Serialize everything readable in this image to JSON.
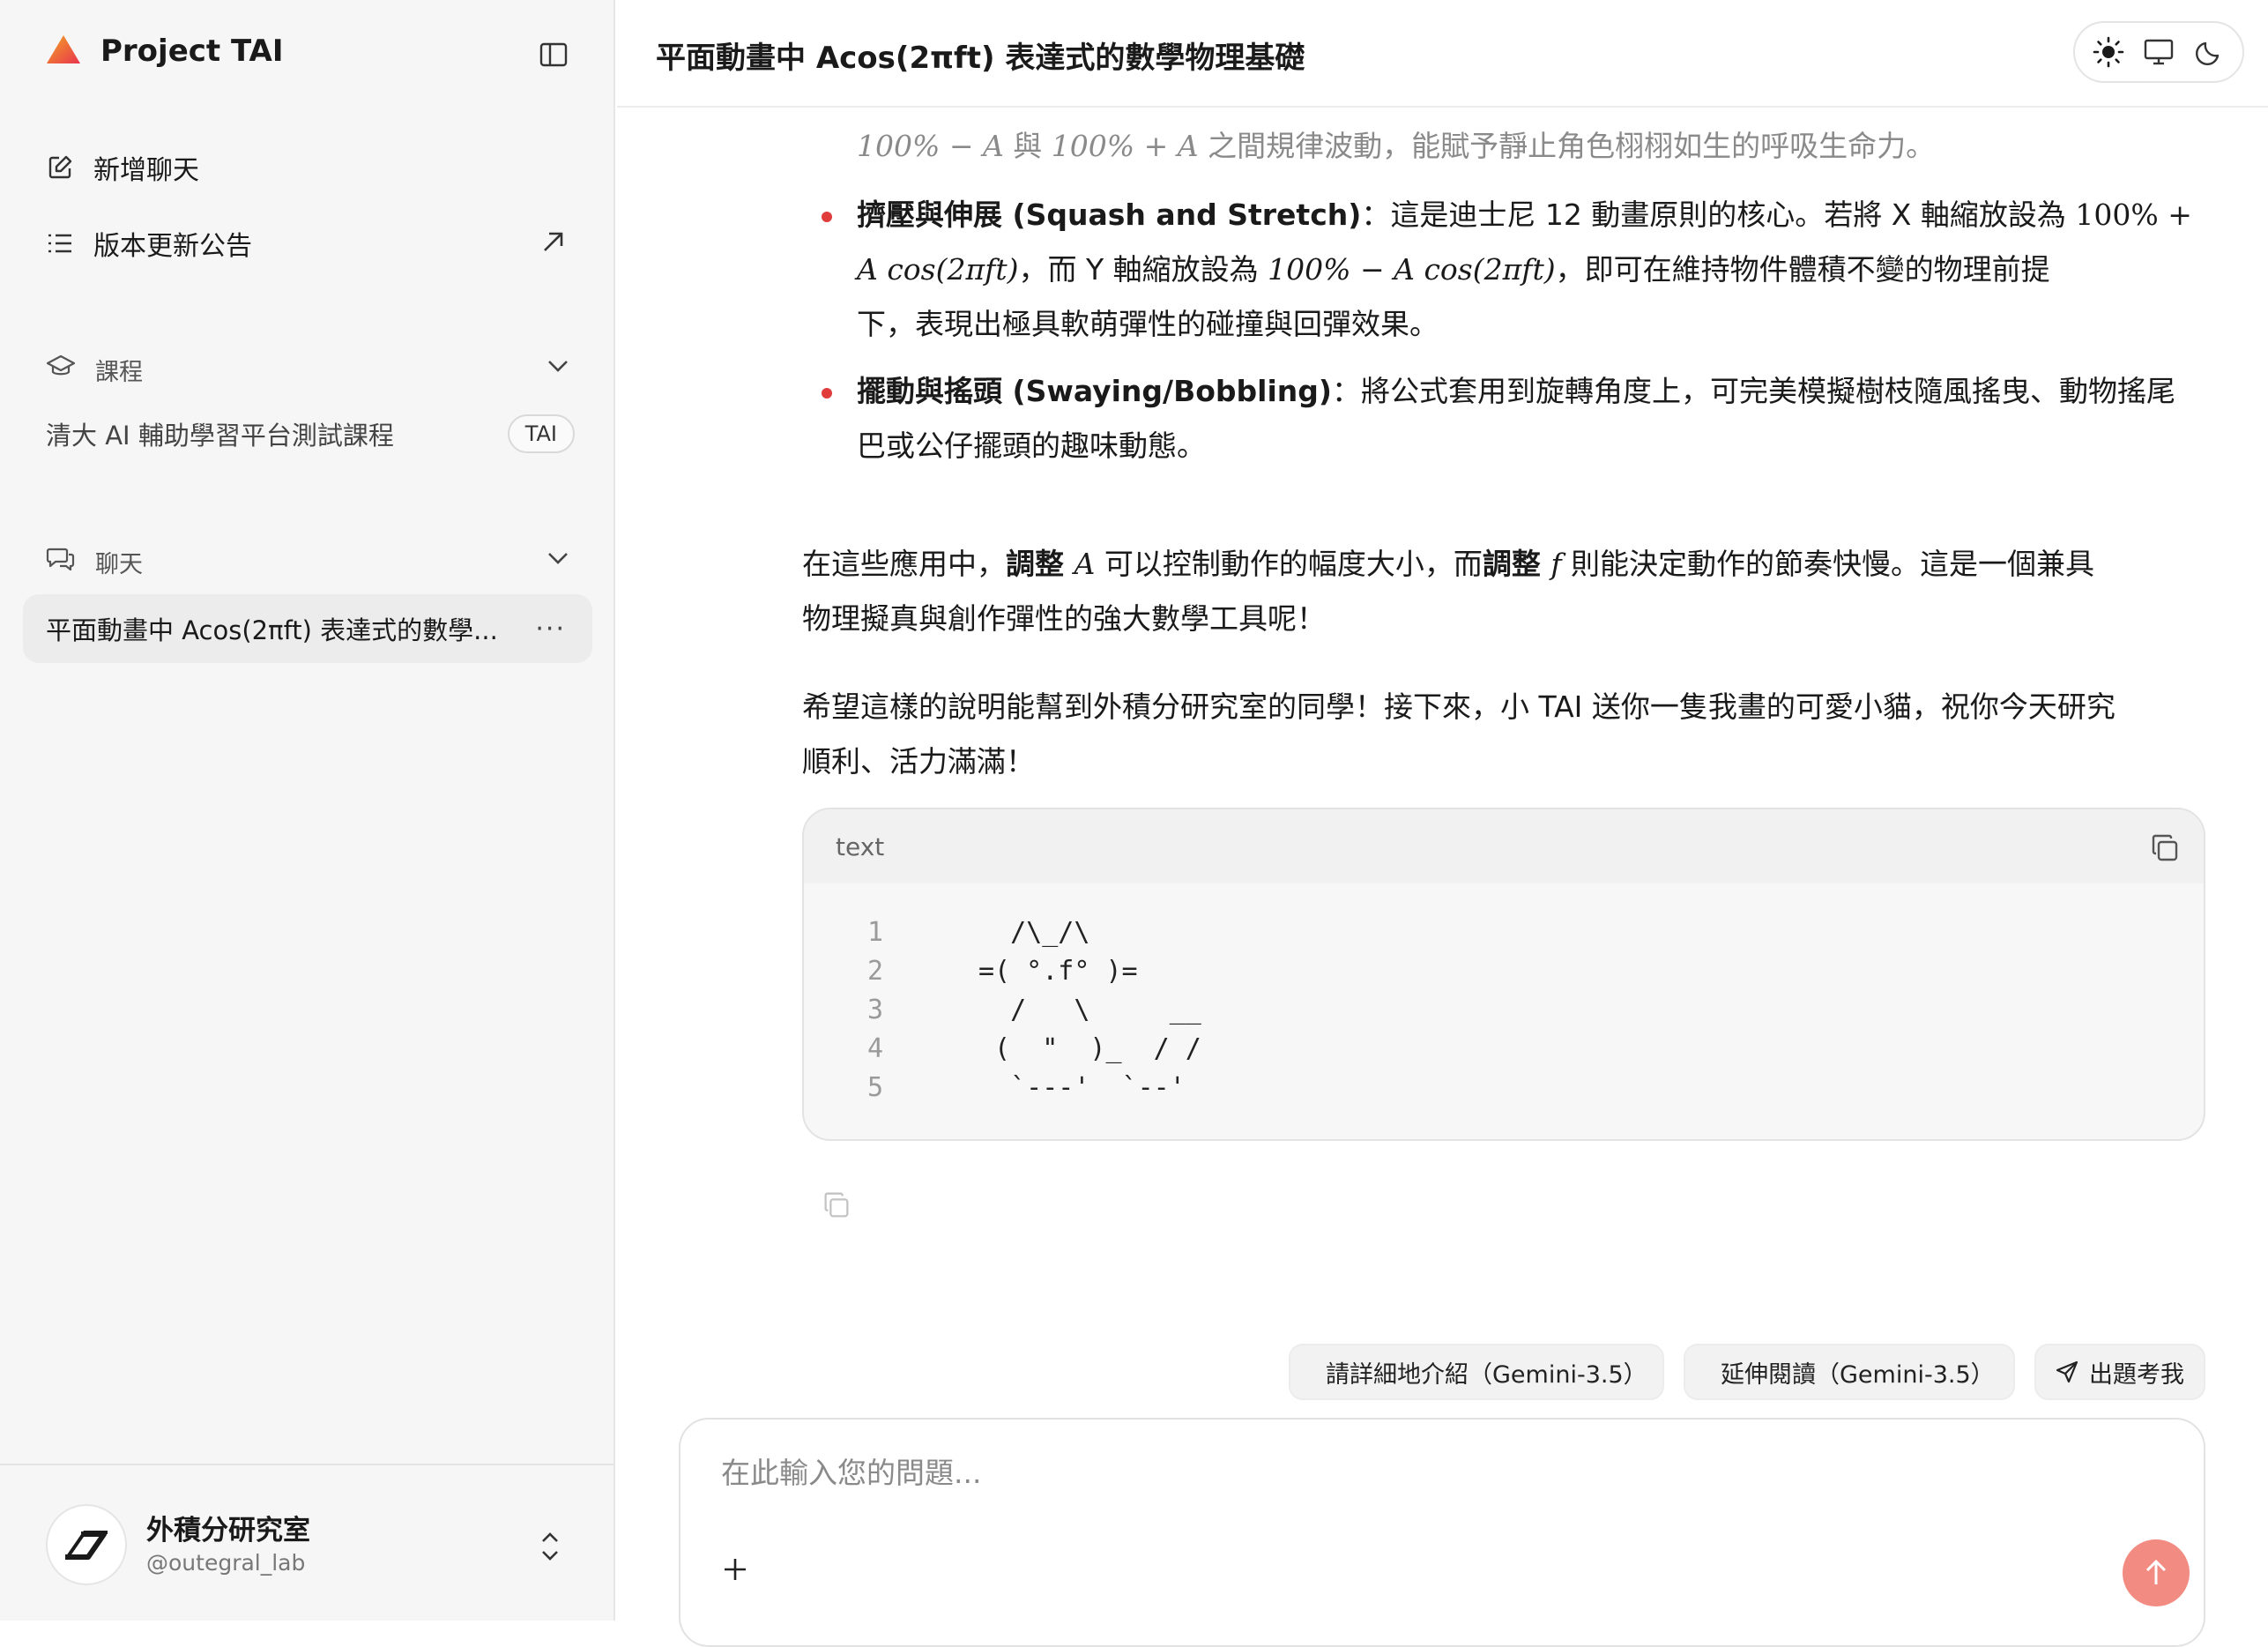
{
  "sidebar": {
    "brand_title": "Project TAI",
    "new_chat": "新增聊天",
    "release_notes": "版本更新公告",
    "courses_heading": "課程",
    "course_name": "清大 AI 輔助學習平台測試課程",
    "course_badge": "TAI",
    "chats_heading": "聊天",
    "active_chat": "平面動畫中 Acos(2πft) 表達式的數學...",
    "more": "···",
    "user_name": "外積分研究室",
    "user_handle": "@outegral_lab"
  },
  "header": {
    "title": "平面動畫中 Acos(2πft) 表達式的數學物理基礎"
  },
  "message": {
    "faded_line_math1": "100% − A",
    "faded_line_mid": " 與 ",
    "faded_line_math2": "100% + A",
    "faded_line_end": " 之間規律波動，能賦予靜止角色栩栩如生的呼吸生命力。",
    "bullet1_title": "擠壓與伸展 (Squash and Stretch)",
    "bullet1_l1_text": "：這是迪士尼 12 動畫原則的核心。若將 X 軸縮放設為 ",
    "bullet1_l1_math": "100% +",
    "bullet1_l2_math1": "A cos(2πft)",
    "bullet1_l2_mid": "，而 Y 軸縮放設為 ",
    "bullet1_l2_math2": "100% − A cos(2πft)",
    "bullet1_l2_end": "，即可在維持物件體積不變的物理前提",
    "bullet1_l3": "下，表現出極具軟萌彈性的碰撞與回彈效果。",
    "bullet2_title": "擺動與搖頭 (Swaying/Bobbling)",
    "bullet2_l1_text": "：將公式套用到旋轉角度上，可完美模擬樹枝隨風搖曳、動物搖尾",
    "bullet2_l2": "巴或公仔擺頭的趣味動態。",
    "p1_a": "在這些應用中，",
    "p1_b": "調整 ",
    "p1_c": "A",
    "p1_d": " 可以控制動作的幅度大小，而",
    "p1_e": "調整 ",
    "p1_f": "f",
    "p1_g": " 則能決定動作的節奏快慢。這是一個兼具",
    "p1_l2": "物理擬真與創作彈性的強大數學工具呢！",
    "p2_l1": "希望這樣的說明能幫到外積分研究室的同學！接下來，小 TAI 送你一隻我畫的可愛小貓，祝你今天研究",
    "p2_l2": "順利、活力滿滿！"
  },
  "code": {
    "language": "text",
    "lines": [
      {
        "n": "1",
        "t": "  /\\_/\\"
      },
      {
        "n": "2",
        "t": "=( °.f° )="
      },
      {
        "n": "3",
        "t": "  /   \\     __"
      },
      {
        "n": "4",
        "t": " (  \"  )_  / /"
      },
      {
        "n": "5",
        "t": "  `---'  `--'"
      }
    ]
  },
  "suggestions": {
    "s1": "請詳細地介紹（Gemini-3.5）",
    "s2": "延伸閱讀（Gemini-3.5）",
    "s3": "出題考我"
  },
  "input": {
    "placeholder": "在此輸入您的問題..."
  },
  "colors": {
    "accent_send": "#f28b82",
    "bullet": "#e03c3c"
  }
}
